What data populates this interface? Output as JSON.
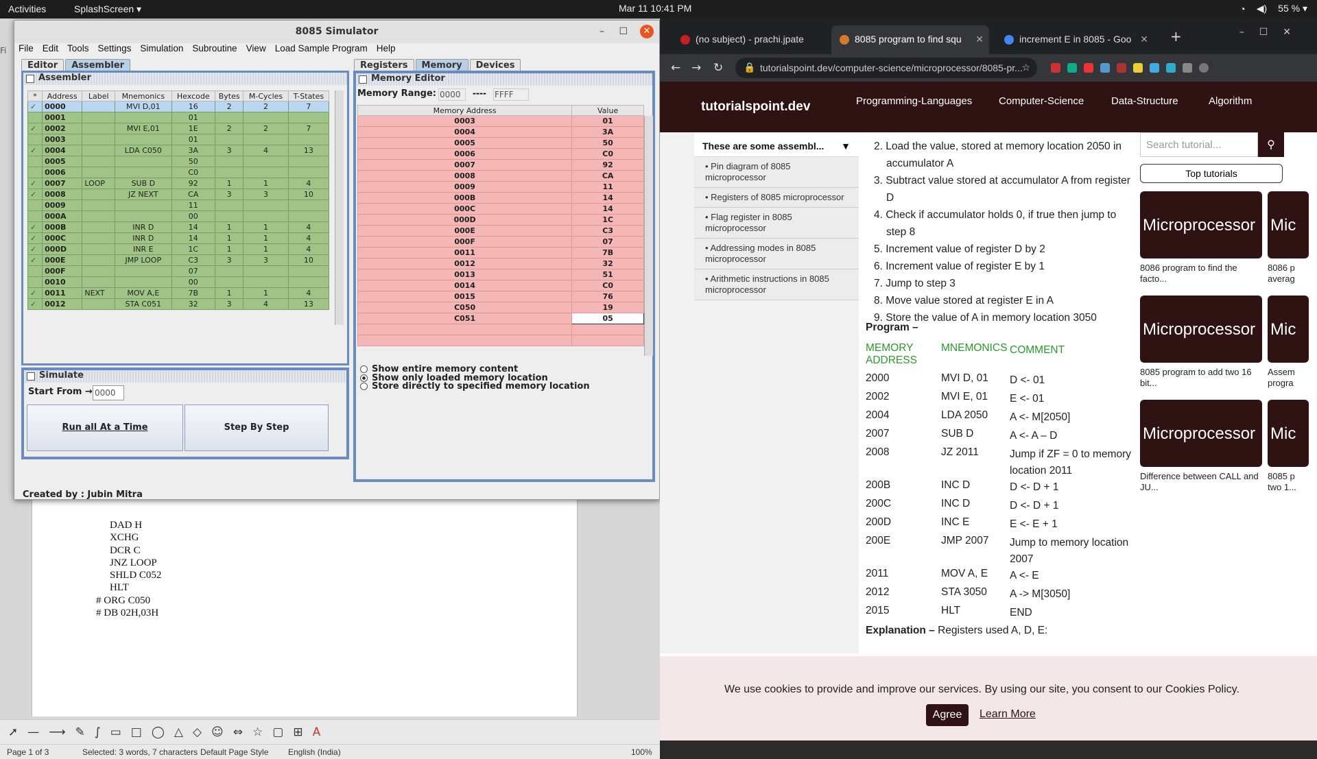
{
  "topbar": {
    "activities": "Activities",
    "app": "SplashScreen ▾",
    "clock": "Mar 11  10:41 PM",
    "battery": "55 % ▾"
  },
  "simulator": {
    "title": "8085 Simulator",
    "menu": [
      "File",
      "Edit",
      "Tools",
      "Settings",
      "Simulation",
      "Subroutine",
      "View",
      "Load Sample Program",
      "Help"
    ],
    "left_tabs": [
      "Editor",
      "Assembler"
    ],
    "right_tabs": [
      "Registers",
      "Memory",
      "Devices"
    ],
    "assembler_title": "Assembler",
    "asm_columns": [
      "*",
      "Address",
      "Label",
      "Mnemonics",
      "Hexcode",
      "Bytes",
      "M-Cycles",
      "T-States"
    ],
    "asm_rows": [
      [
        "✓",
        "0000",
        "",
        "MVI D,01",
        "16",
        "2",
        "2",
        "7"
      ],
      [
        "",
        "0001",
        "",
        "",
        "01",
        "",
        "",
        ""
      ],
      [
        "✓",
        "0002",
        "",
        "MVI E,01",
        "1E",
        "2",
        "2",
        "7"
      ],
      [
        "",
        "0003",
        "",
        "",
        "01",
        "",
        "",
        ""
      ],
      [
        "✓",
        "0004",
        "",
        "LDA C050",
        "3A",
        "3",
        "4",
        "13"
      ],
      [
        "",
        "0005",
        "",
        "",
        "50",
        "",
        "",
        ""
      ],
      [
        "",
        "0006",
        "",
        "",
        "C0",
        "",
        "",
        ""
      ],
      [
        "✓",
        "0007",
        "LOOP",
        "SUB D",
        "92",
        "1",
        "1",
        "4"
      ],
      [
        "✓",
        "0008",
        "",
        "JZ NEXT",
        "CA",
        "3",
        "3",
        "10"
      ],
      [
        "",
        "0009",
        "",
        "",
        "11",
        "",
        "",
        ""
      ],
      [
        "",
        "000A",
        "",
        "",
        "00",
        "",
        "",
        ""
      ],
      [
        "✓",
        "000B",
        "",
        "INR D",
        "14",
        "1",
        "1",
        "4"
      ],
      [
        "✓",
        "000C",
        "",
        "INR D",
        "14",
        "1",
        "1",
        "4"
      ],
      [
        "✓",
        "000D",
        "",
        "INR E",
        "1C",
        "1",
        "1",
        "4"
      ],
      [
        "✓",
        "000E",
        "",
        "JMP LOOP",
        "C3",
        "3",
        "3",
        "10"
      ],
      [
        "",
        "000F",
        "",
        "",
        "07",
        "",
        "",
        ""
      ],
      [
        "",
        "0010",
        "",
        "",
        "00",
        "",
        "",
        ""
      ],
      [
        "✓",
        "0011",
        "NEXT",
        "MOV A,E",
        "7B",
        "1",
        "1",
        "4"
      ],
      [
        "✓",
        "0012",
        "",
        "STA C051",
        "32",
        "3",
        "4",
        "13"
      ]
    ],
    "simulate_title": "Simulate",
    "start_from_label": "Start From  →",
    "start_from_value": "0000",
    "run_all": "Run all At a Time",
    "step_by_step": "Step By Step",
    "created_by": "Created by : Jubin Mitra",
    "memory_editor_title": "Memory Editor",
    "memory_range_label": "Memory Range:",
    "range_from": "0000",
    "range_sep": "----",
    "range_to": "FFFF",
    "mem_columns": [
      "Memory Address",
      "Value"
    ],
    "mem_rows": [
      [
        "0003",
        "01"
      ],
      [
        "0004",
        "3A"
      ],
      [
        "0005",
        "50"
      ],
      [
        "0006",
        "C0"
      ],
      [
        "0007",
        "92"
      ],
      [
        "0008",
        "CA"
      ],
      [
        "0009",
        "11"
      ],
      [
        "000B",
        "14"
      ],
      [
        "000C",
        "14"
      ],
      [
        "000D",
        "1C"
      ],
      [
        "000E",
        "C3"
      ],
      [
        "000F",
        "07"
      ],
      [
        "0011",
        "7B"
      ],
      [
        "0012",
        "32"
      ],
      [
        "0013",
        "51"
      ],
      [
        "0014",
        "C0"
      ],
      [
        "0015",
        "76"
      ],
      [
        "C050",
        "19"
      ],
      [
        "C051",
        "05"
      ]
    ],
    "radio_options": [
      "Show entire memory content",
      "Show only loaded memory location",
      "Store directly to specified memory location"
    ],
    "radio_selected": 1
  },
  "writer": {
    "code_lines": [
      "DAD H",
      "XCHG",
      "DCR C",
      "JNZ LOOP",
      "SHLD C052",
      "HLT",
      "# ORG C050",
      "# DB 02H,03H"
    ],
    "status": {
      "page": "Page 1 of 3",
      "selected": "Selected: 3 words, 7 characters",
      "style": "Default Page Style",
      "lang": "English (India)",
      "zoom": "100%"
    }
  },
  "chrome": {
    "tabs": [
      "(no subject) - prachi.jpate",
      "8085 program to find squ",
      "increment E in 8085 - Goo"
    ],
    "url": "tutorialspoint.dev/computer-science/microprocessor/8085-pr...",
    "logo": "tutorialspoint.dev",
    "nav": [
      "Programming-Languages",
      "Computer-Science",
      "Data-Structure",
      "Algorithm"
    ],
    "sidebar_header": "These are some assembl...",
    "sidebar_items": [
      "Pin diagram of 8085 microprocessor",
      "Registers of 8085 microprocessor",
      "Flag register in 8085 microprocessor",
      "Addressing modes in 8085 microprocessor",
      "Arithmetic instructions in 8085 microprocessor"
    ],
    "steps": [
      "2. Load the value, stored at memory location 2050 in accumulator A",
      "3. Subtract value stored at accumulator A from register D",
      "4. Check if accumulator holds 0, if true then jump to step 8",
      "5. Increment value of register D by 2",
      "6. Increment value of register E by 1",
      "7. Jump to step 3",
      "8. Move value stored at register E in A",
      "9. Store the value of A in memory location 3050"
    ],
    "program_label": "Program –",
    "prog_headers": [
      "MEMORY ADDRESS",
      "MNEMONICS",
      "COMMENT"
    ],
    "prog_rows": [
      [
        "2000",
        "MVI D, 01",
        "D <- 01"
      ],
      [
        "2002",
        "MVI E, 01",
        "E <- 01"
      ],
      [
        "2004",
        "LDA 2050",
        "A <- M[2050]"
      ],
      [
        "2007",
        "SUB D",
        "A <- A – D"
      ],
      [
        "2008",
        "JZ 2011",
        "Jump if ZF = 0 to memory location 2011"
      ],
      [
        "200B",
        "INC D",
        "D <- D + 1"
      ],
      [
        "200C",
        "INC D",
        "D <- D + 1"
      ],
      [
        "200D",
        "INC E",
        "E <- E + 1"
      ],
      [
        "200E",
        "JMP 2007",
        "Jump to memory location 2007"
      ],
      [
        "2011",
        "MOV A, E",
        "A <- E"
      ],
      [
        "2012",
        "STA 3050",
        "A -> M[3050]"
      ],
      [
        "2015",
        "HLT",
        "END"
      ]
    ],
    "explanation_label": "Explanation –",
    "explanation_text": " Registers used A, D, E:",
    "search_placeholder": "Search tutorial...",
    "top_tutorials": "Top tutorials",
    "card_text": "Microprocessor",
    "card_text_short": "Mic",
    "card_captions": [
      "8086 program to find the facto...",
      "8086 p averag",
      "8085 program to add two 16 bit...",
      "Assem progra",
      "Difference between CALL and JU...",
      "8085 p two 1..."
    ],
    "cookie_msg": "We use cookies to provide and improve our services. By using our site, you consent to our Cookies Policy.",
    "agree": "Agree",
    "learn_more": "Learn More"
  },
  "colors": {
    "asm_row": "#a0c486",
    "mem_row": "#f5b6b6",
    "site_brand": "#2e1312",
    "close_btn": "#e95420"
  }
}
